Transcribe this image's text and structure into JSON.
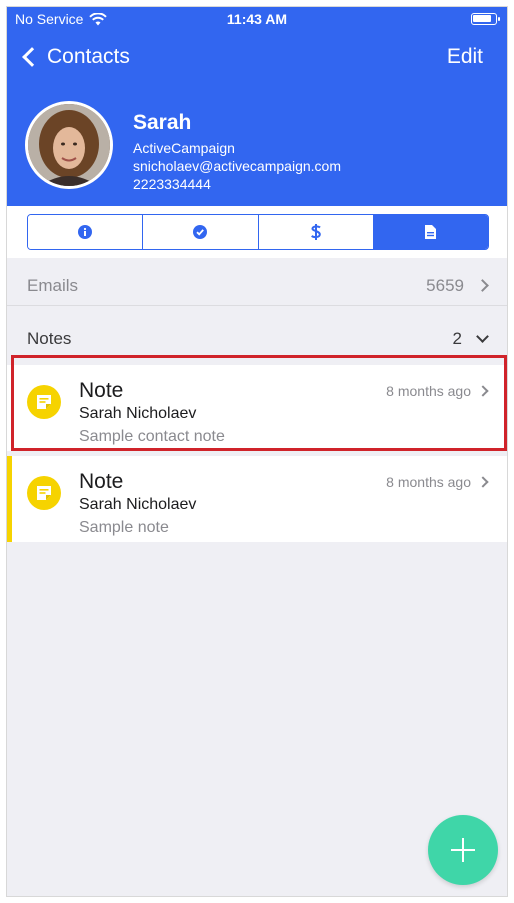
{
  "status_bar": {
    "carrier": "No Service",
    "time": "11:43 AM"
  },
  "nav": {
    "back_label": "Contacts",
    "edit_label": "Edit"
  },
  "contact": {
    "name": "Sarah",
    "organization": "ActiveCampaign",
    "email": "snicholaev@activecampaign.com",
    "phone": "2223334444"
  },
  "tabs": [
    {
      "icon": "info-icon",
      "active": false
    },
    {
      "icon": "check-circle-icon",
      "active": false
    },
    {
      "icon": "dollar-icon",
      "active": false
    },
    {
      "icon": "document-icon",
      "active": true
    }
  ],
  "emails_section": {
    "label": "Emails",
    "count": "5659"
  },
  "notes_section": {
    "label": "Notes",
    "count": "2"
  },
  "notes": [
    {
      "title": "Note",
      "author": "Sarah Nicholaev",
      "body": "Sample contact note",
      "time": "8 months ago",
      "icon": "note-icon"
    },
    {
      "title": "Note",
      "author": "Sarah Nicholaev",
      "body": "Sample note",
      "time": "8 months ago",
      "icon": "note-icon"
    }
  ],
  "colors": {
    "brand_blue": "#3266f0",
    "note_yellow": "#f6d300",
    "fab_green": "#3fd6a8",
    "highlight_red": "#d0232a"
  }
}
